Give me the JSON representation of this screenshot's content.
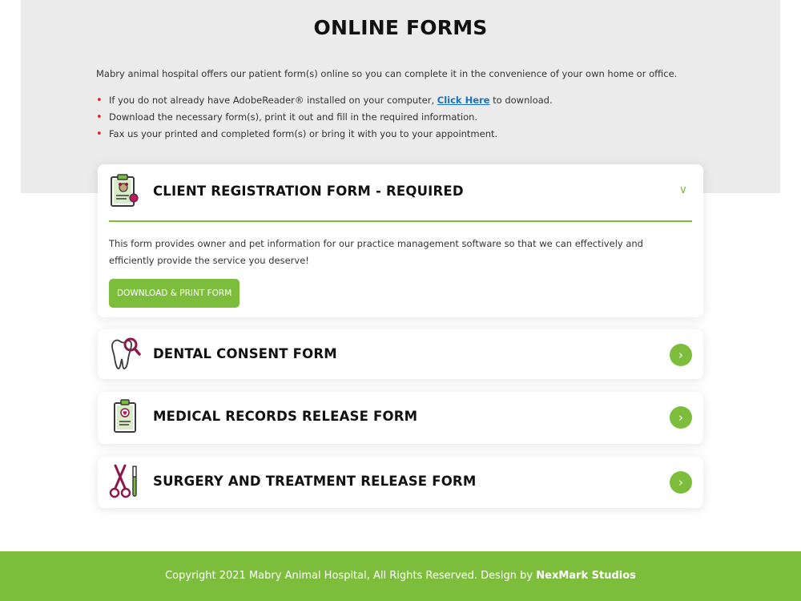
{
  "page": {
    "title_light": "ONLINE",
    "title_bold": "FORMS",
    "intro": "Mabry animal hospital offers our patient form(s) online so you can complete it in the convenience of your own home or office.",
    "bullets": {
      "b1_pre": "If you do not already have AdobeReader® installed on your computer,",
      "b1_link": "Click Here",
      "b1_post": "to download.",
      "b2": "Download the necessary form(s), print it out and fill in the required information.",
      "b3": "Fax us your printed and completed form(s) or bring it with you to your appointment."
    }
  },
  "forms": [
    {
      "title": "CLIENT REGISTRATION FORM - REQUIRED",
      "icon": "clipboard-pet-icon",
      "expanded": true,
      "description": "This form provides owner and pet information for our practice management software so that we can effectively and efficiently provide the service you deserve!",
      "button": "DOWNLOAD & PRINT FORM"
    },
    {
      "title": "DENTAL CONSENT FORM",
      "icon": "tooth-magnifier-icon",
      "expanded": false
    },
    {
      "title": "MEDICAL RECORDS RELEASE FORM",
      "icon": "clipboard-heart-icon",
      "expanded": false
    },
    {
      "title": "SURGERY AND TREATMENT RELEASE FORM",
      "icon": "scissors-scalpel-icon",
      "expanded": false
    }
  ],
  "footer": {
    "text": "Copyright 2021 Mabry Animal Hospital, All Rights Reserved. Design by",
    "brand": "NexMark Studios"
  },
  "colors": {
    "accent": "#7dbd3c",
    "hero_bg": "#ebebeb",
    "bullet": "#e02020",
    "link": "#1a73c4",
    "icon_maroon": "#8b1a4a"
  }
}
